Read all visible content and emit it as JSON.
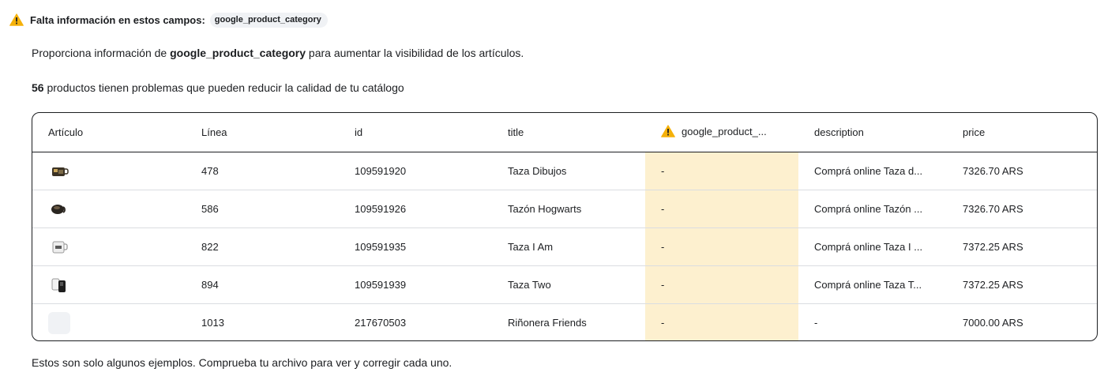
{
  "alert": {
    "label": "Falta información en estos campos:",
    "field_chip": "google_product_category",
    "icon": "warning-triangle-icon",
    "icon_color": "#f5b10a"
  },
  "intro": {
    "prefix": "Proporciona información de ",
    "field": "google_product_category",
    "suffix": " para aumentar la visibilidad de los artículos."
  },
  "summary": {
    "count": "56",
    "text": " productos tienen problemas que pueden reducir la calidad de tu catálogo"
  },
  "table": {
    "columns": [
      {
        "key": "article",
        "label": "Artículo"
      },
      {
        "key": "line",
        "label": "Línea"
      },
      {
        "key": "id",
        "label": "id"
      },
      {
        "key": "title",
        "label": "title"
      },
      {
        "key": "gpc",
        "label": "google_product_..."
      },
      {
        "key": "description",
        "label": "description"
      },
      {
        "key": "price",
        "label": "price"
      }
    ],
    "highlight_color": "#fdf0cf",
    "rows": [
      {
        "thumb": "mug-dibujos",
        "line": "478",
        "id": "109591920",
        "title": "Taza Dibujos",
        "gpc": "-",
        "description": "Comprá online Taza d...",
        "price": "7326.70 ARS"
      },
      {
        "thumb": "mug-hogwarts",
        "line": "586",
        "id": "109591926",
        "title": "Tazón Hogwarts",
        "gpc": "-",
        "description": "Comprá online Tazón ...",
        "price": "7326.70 ARS"
      },
      {
        "thumb": "mug-i-am",
        "line": "822",
        "id": "109591935",
        "title": "Taza I Am",
        "gpc": "-",
        "description": "Comprá online Taza I ...",
        "price": "7372.25 ARS"
      },
      {
        "thumb": "mug-two",
        "line": "894",
        "id": "109591939",
        "title": "Taza Two",
        "gpc": "-",
        "description": "Comprá online Taza T...",
        "price": "7372.25 ARS"
      },
      {
        "thumb": "empty",
        "line": "1013",
        "id": "217670503",
        "title": "Riñonera Friends",
        "gpc": "-",
        "description": "-",
        "price": "7000.00 ARS"
      }
    ]
  },
  "footer": {
    "note": "Estos son solo algunos ejemplos. Comprueba tu archivo para ver y corregir cada uno."
  }
}
